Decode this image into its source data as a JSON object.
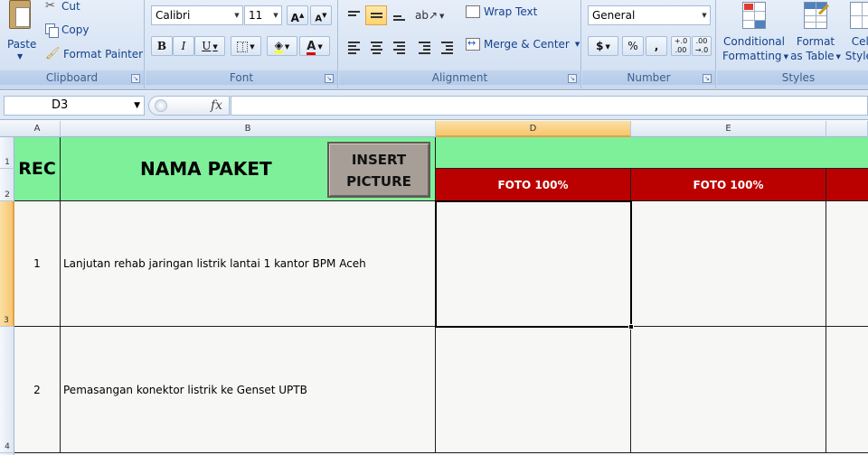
{
  "ribbon": {
    "clipboard": {
      "label": "Clipboard",
      "paste": "Paste",
      "cut": "Cut",
      "copy": "Copy",
      "format_painter": "Format Painter"
    },
    "font": {
      "label": "Font",
      "name": "Calibri",
      "size": "11",
      "grow": "A",
      "shrink": "A",
      "bold": "B",
      "italic": "I",
      "underline": "U",
      "font_color_glyph": "A"
    },
    "alignment": {
      "label": "Alignment",
      "wrap_text": "Wrap Text",
      "merge_center": "Merge & Center"
    },
    "number": {
      "label": "Number",
      "format": "General",
      "currency": "$",
      "percent": "%",
      "comma": ",",
      "inc_decimal": "+.0 .00",
      "dec_decimal": ".00 →.0"
    },
    "styles": {
      "label": "Styles",
      "conditional_1": "Conditional",
      "conditional_2": "Formatting",
      "format_table_1": "Format",
      "format_table_2": "as Table",
      "cell_styles_1": "Cell",
      "cell_styles_2": "Styles"
    }
  },
  "formula_bar": {
    "name_box": "D3",
    "fx": "fx",
    "value": ""
  },
  "columns": [
    "A",
    "B",
    "D",
    "E"
  ],
  "rows": [
    "1",
    "2",
    "3",
    "4"
  ],
  "sheet": {
    "header_rec": "REC",
    "header_nama": "NAMA PAKET",
    "insert_picture_1": "INSERT",
    "insert_picture_2": "PICTURE",
    "foto_d": "FOTO 100%",
    "foto_e": "FOTO 100%",
    "rows": [
      {
        "rec": "1",
        "nama": "Lanjutan rehab jaringan listrik lantai 1 kantor BPM Aceh"
      },
      {
        "rec": "2",
        "nama": "Pemasangan konektor listrik ke Genset UPTB"
      }
    ]
  },
  "colors": {
    "header_green": "#7ef09a",
    "foto_red": "#bb0000",
    "button_gray": "#a69e97",
    "selection": "#f7c66f"
  }
}
